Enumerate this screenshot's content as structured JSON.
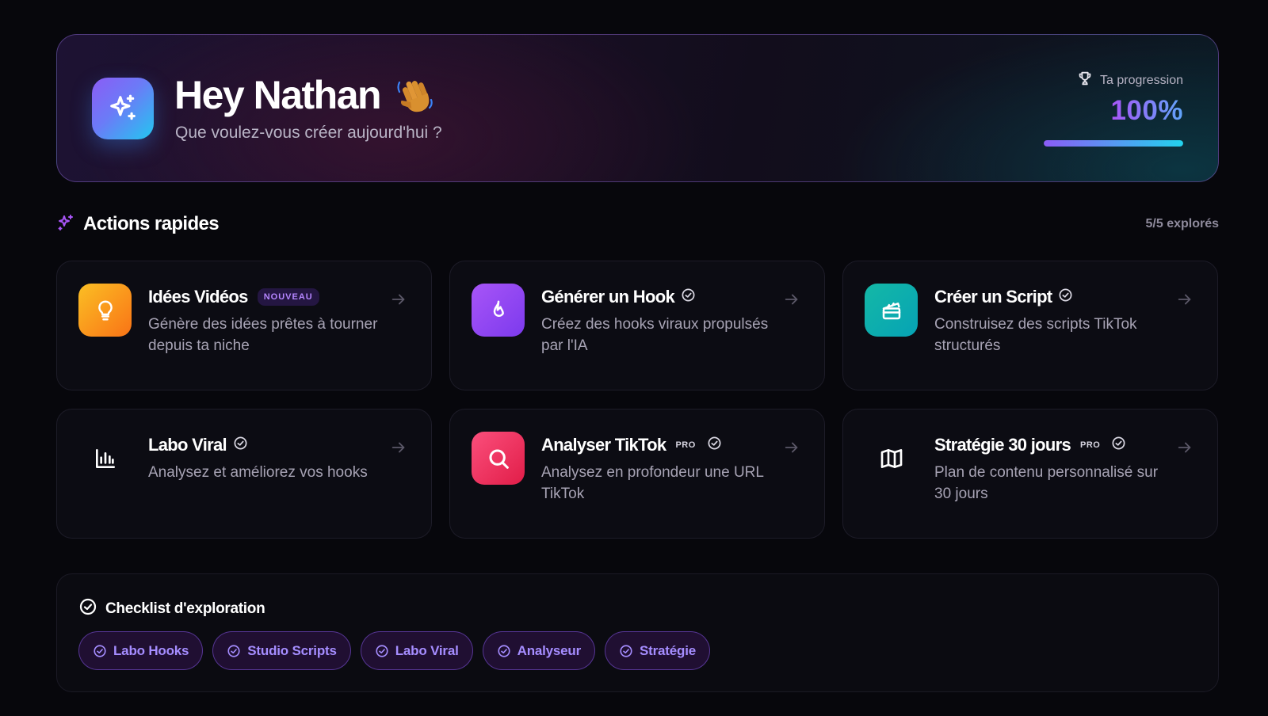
{
  "hero": {
    "greeting": "Hey Nathan",
    "subtitle": "Que voulez-vous créer aujourd'hui ?",
    "progress_label": "Ta progression",
    "progress_value": "100%",
    "progress_fraction": 1.0
  },
  "quick_actions": {
    "title": "Actions rapides",
    "explored": "5/5 explorés",
    "cards": [
      {
        "title": "Idées Vidéos",
        "badge": "NOUVEAU",
        "description": "Génère des idées prêtes à tourner depuis ta niche",
        "icon": "lightbulb-icon",
        "color": "#f59e0b"
      },
      {
        "title": "Générer un Hook",
        "description": "Créez des hooks viraux propulsés par l'IA",
        "icon": "flame-icon",
        "color": "#8b5cf6"
      },
      {
        "title": "Créer un Script",
        "description": "Construisez des scripts TikTok structurés",
        "icon": "clapperboard-icon",
        "color": "#14b8a6"
      },
      {
        "title": "Labo Viral",
        "description": "Analysez et améliorez vos hooks",
        "icon": "bar-chart-icon"
      },
      {
        "title": "Analyser TikTok",
        "badge": "PRO",
        "description": "Analysez en profondeur une URL TikTok",
        "icon": "search-icon",
        "color": "#f43f5e"
      },
      {
        "title": "Stratégie 30 jours",
        "badge": "PRO",
        "description": "Plan de contenu personnalisé sur 30 jours",
        "icon": "map-icon"
      }
    ]
  },
  "checklist": {
    "title": "Checklist d'exploration",
    "chips": [
      "Labo Hooks",
      "Studio Scripts",
      "Labo Viral",
      "Analyseur",
      "Stratégie"
    ]
  },
  "colors": {
    "accent_purple": "#8b5cf6",
    "accent_cyan": "#22d3ee",
    "background": "#07070c"
  }
}
